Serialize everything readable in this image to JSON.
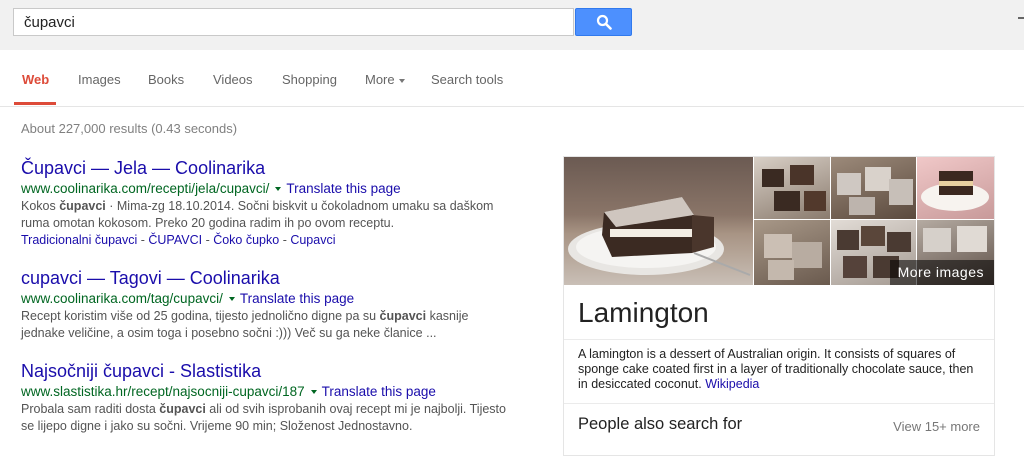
{
  "search": {
    "query": "čupavci"
  },
  "tabs": [
    {
      "label": "Web"
    },
    {
      "label": "Images"
    },
    {
      "label": "Books"
    },
    {
      "label": "Videos"
    },
    {
      "label": "Shopping"
    },
    {
      "label": "More"
    },
    {
      "label": "Search tools"
    }
  ],
  "stats": "About 227,000 results (0.43 seconds)",
  "results": [
    {
      "title": "Čupavci — Jela — Coolinarika",
      "url": "www.coolinarika.com/recepti/jela/cupavci/",
      "translate": "Translate this page",
      "snippet_1_pre": "Kokos ",
      "snippet_1_bold": "čupavci",
      "snippet_1_post": " · Mima-zg 18.10.2014. Sočni biskvit u čokoladnom umaku sa daškom",
      "snippet_2": "ruma omotan kokosom. Preko 20 godina radim ih po ovom receptu.",
      "sitelinks": [
        "Tradicionalni čupavci",
        "ČUPAVCI",
        "Čoko čupko",
        "Cupavci"
      ]
    },
    {
      "title": "cupavci — Tagovi — Coolinarika",
      "url": "www.coolinarika.com/tag/cupavci/",
      "translate": "Translate this page",
      "snippet_1_pre": "Recept koristim više od 25 godina, tijesto jednolično digne pa su ",
      "snippet_1_bold": "čupavci",
      "snippet_1_post": " kasnije",
      "snippet_2": "jednake veličine, a osim toga i posebno sočni :))) Več su ga neke članice ..."
    },
    {
      "title": "Najsočniji čupavci - Slastistika",
      "url": "www.slastistika.hr/recept/najsocniji-cupavci/187",
      "translate": "Translate this page",
      "snippet_1_pre": "Probala sam raditi dosta ",
      "snippet_1_bold": "čupavci",
      "snippet_1_post": " ali od svih isprobanih ovaj recept mi je najbolji. Tijesto",
      "snippet_2": "se lijepo digne i jako su sočni. Vrijeme 90 min; Složenost Jednostavno."
    }
  ],
  "knowledge_panel": {
    "more_images": "More images",
    "title": "Lamington",
    "description": "A lamington is a dessert of Australian origin. It consists of squares of sponge cake coated first in a layer of traditionally chocolate sauce, then in desiccated coconut.",
    "source": "Wikipedia",
    "people_also_search": "People also search for",
    "view_more": "View 15+ more"
  },
  "colors": {
    "search_button": "#4d90fe",
    "active_tab": "#dd4b39",
    "link": "#1a0dab",
    "url": "#006621"
  }
}
